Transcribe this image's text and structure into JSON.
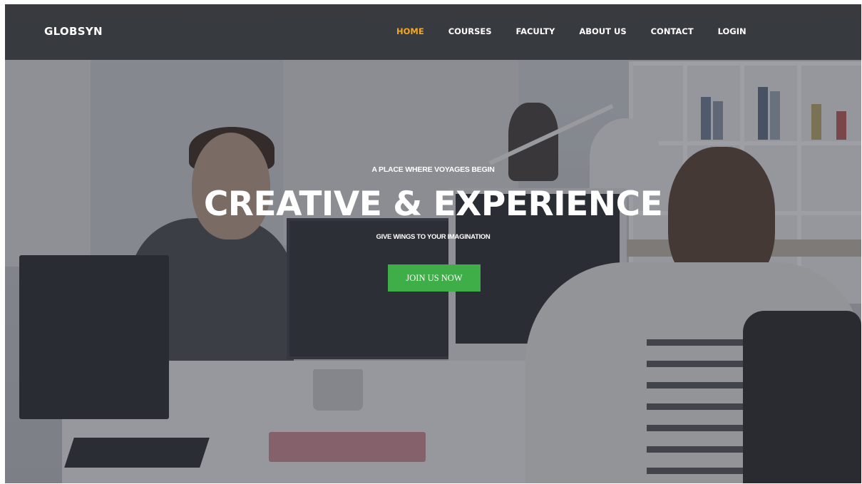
{
  "brand": {
    "name": "GLOBSYN"
  },
  "nav": {
    "items": [
      {
        "label": "HOME",
        "active": true
      },
      {
        "label": "COURSES",
        "active": false
      },
      {
        "label": "FACULTY",
        "active": false
      },
      {
        "label": "ABOUT US",
        "active": false
      },
      {
        "label": "CONTACT",
        "active": false
      },
      {
        "label": "LOGIN",
        "active": false
      }
    ]
  },
  "hero": {
    "tagline": "A PLACE WHERE VOYAGES BEGIN",
    "headline": "CREATIVE & EXPERIENCE",
    "subline": "GIVE WINGS TO YOUR IMAGINATION",
    "cta_label": "JOIN US NOW"
  },
  "colors": {
    "accent_active_nav": "#f5a623",
    "cta_background": "#3fae49",
    "navbar_background": "#26282c"
  }
}
